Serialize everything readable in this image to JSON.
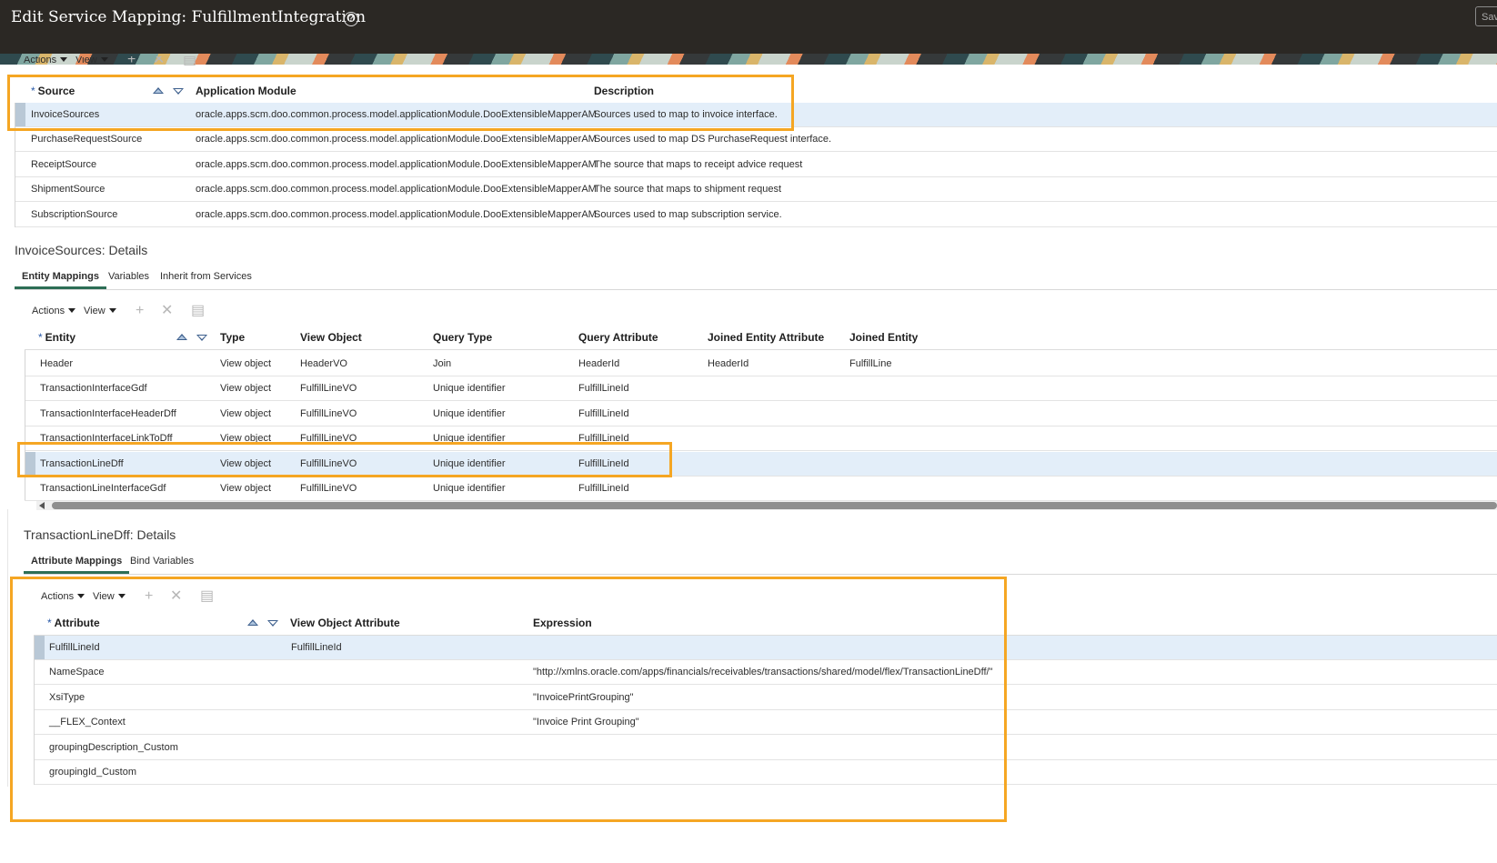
{
  "header": {
    "title": "Edit Service Mapping: FulfillmentIntegration",
    "save_label": "Sav"
  },
  "sources": {
    "toolbar": {
      "actions": "Actions",
      "view": "View"
    },
    "columns": {
      "source": "Source",
      "app_module": "Application Module",
      "description": "Description"
    },
    "rows": [
      {
        "source": "InvoiceSources",
        "module": "oracle.apps.scm.doo.common.process.model.applicationModule.DooExtensibleMapperAM",
        "description": "Sources used to map to invoice interface."
      },
      {
        "source": "PurchaseRequestSource",
        "module": "oracle.apps.scm.doo.common.process.model.applicationModule.DooExtensibleMapperAM",
        "description": "Sources used to map DS PurchaseRequest interface."
      },
      {
        "source": "ReceiptSource",
        "module": "oracle.apps.scm.doo.common.process.model.applicationModule.DooExtensibleMapperAM",
        "description": "The source that maps to receipt advice request"
      },
      {
        "source": "ShipmentSource",
        "module": "oracle.apps.scm.doo.common.process.model.applicationModule.DooExtensibleMapperAM",
        "description": "The source that maps to shipment request"
      },
      {
        "source": "SubscriptionSource",
        "module": "oracle.apps.scm.doo.common.process.model.applicationModule.DooExtensibleMapperAM",
        "description": "Sources used to map subscription service."
      }
    ]
  },
  "source_details": {
    "title": "InvoiceSources: Details",
    "tabs": [
      "Entity Mappings",
      "Variables",
      "Inherit from Services"
    ],
    "toolbar": {
      "actions": "Actions",
      "view": "View"
    },
    "columns": {
      "entity": "Entity",
      "type": "Type",
      "view_object": "View Object",
      "query_type": "Query Type",
      "query_attribute": "Query Attribute",
      "joined_entity_attribute": "Joined Entity Attribute",
      "joined_entity": "Joined Entity"
    },
    "rows": [
      {
        "entity": "Header",
        "type": "View object",
        "vo": "HeaderVO",
        "qtype": "Join",
        "qattr": "HeaderId",
        "jattr": "HeaderId",
        "jentity": "FulfillLine"
      },
      {
        "entity": "TransactionInterfaceGdf",
        "type": "View object",
        "vo": "FulfillLineVO",
        "qtype": "Unique identifier",
        "qattr": "FulfillLineId",
        "jattr": "",
        "jentity": ""
      },
      {
        "entity": "TransactionInterfaceHeaderDff",
        "type": "View object",
        "vo": "FulfillLineVO",
        "qtype": "Unique identifier",
        "qattr": "FulfillLineId",
        "jattr": "",
        "jentity": ""
      },
      {
        "entity": "TransactionInterfaceLinkToDff",
        "type": "View object",
        "vo": "FulfillLineVO",
        "qtype": "Unique identifier",
        "qattr": "FulfillLineId",
        "jattr": "",
        "jentity": ""
      },
      {
        "entity": "TransactionLineDff",
        "type": "View object",
        "vo": "FulfillLineVO",
        "qtype": "Unique identifier",
        "qattr": "FulfillLineId",
        "jattr": "",
        "jentity": ""
      },
      {
        "entity": "TransactionLineInterfaceGdf",
        "type": "View object",
        "vo": "FulfillLineVO",
        "qtype": "Unique identifier",
        "qattr": "FulfillLineId",
        "jattr": "",
        "jentity": ""
      }
    ]
  },
  "entity_details": {
    "title": "TransactionLineDff: Details",
    "tabs": [
      "Attribute Mappings",
      "Bind Variables"
    ],
    "toolbar": {
      "actions": "Actions",
      "view": "View"
    },
    "columns": {
      "attribute": "Attribute",
      "vo_attribute": "View Object Attribute",
      "expression": "Expression"
    },
    "rows": [
      {
        "attribute": "FulfillLineId",
        "vo_attr": "FulfillLineId",
        "expression": ""
      },
      {
        "attribute": "NameSpace",
        "vo_attr": "",
        "expression": "\"http://xmlns.oracle.com/apps/financials/receivables/transactions/shared/model/flex/TransactionLineDff/\""
      },
      {
        "attribute": "XsiType",
        "vo_attr": "",
        "expression": "\"InvoicePrintGrouping\""
      },
      {
        "attribute": "__FLEX_Context",
        "vo_attr": "",
        "expression": "\"Invoice Print Grouping\""
      },
      {
        "attribute": "groupingDescription_Custom",
        "vo_attr": "",
        "expression": ""
      },
      {
        "attribute": "groupingId_Custom",
        "vo_attr": "",
        "expression": ""
      }
    ]
  },
  "colors": {
    "header_bg": "#2b2824",
    "highlight": "#f5a623",
    "selected_row": "#e3eef9",
    "active_tab": "#2d6e56"
  }
}
